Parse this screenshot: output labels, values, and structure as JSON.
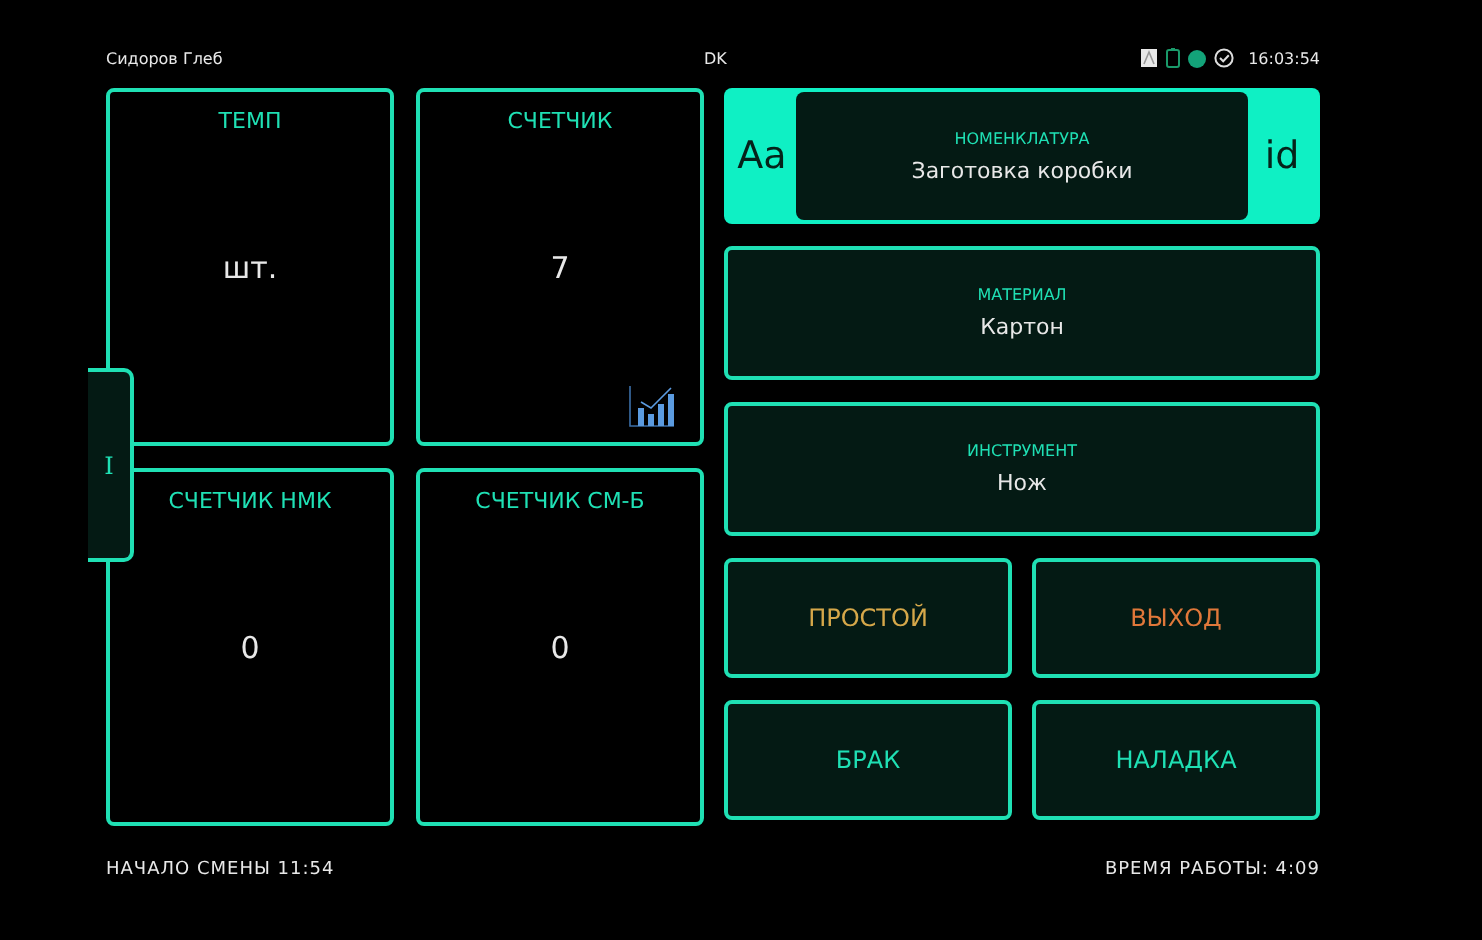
{
  "header": {
    "user": "Сидоров Глеб",
    "code": "DK",
    "time": "16:03:54"
  },
  "side_tab": {
    "label": "I"
  },
  "tiles": [
    {
      "title": "ТЕМП",
      "value": "шт.",
      "has_chart": false
    },
    {
      "title": "СЧЕТЧИК",
      "value": "7",
      "has_chart": true
    },
    {
      "title": "СЧЕТЧИК НМК",
      "value": "0",
      "has_chart": false
    },
    {
      "title": "СЧЕТЧИК СМ-Б",
      "value": "0",
      "has_chart": false
    }
  ],
  "nomenclature": {
    "left": "Aa",
    "label": "НОМЕНКЛАТУРА",
    "value": "Заготовка коробки",
    "right": "id"
  },
  "fields": [
    {
      "label": "МАТЕРИАЛ",
      "value": "Картон"
    },
    {
      "label": "ИНСТРУМЕНТ",
      "value": "Нож"
    }
  ],
  "buttons": [
    {
      "label": "ПРОСТОЙ",
      "color": "#d6a84a"
    },
    {
      "label": "ВЫХОД",
      "color": "#e0783a"
    },
    {
      "label": "БРАК",
      "color": "#1fe0b4"
    },
    {
      "label": "НАЛАДКА",
      "color": "#1fe0b4"
    }
  ],
  "footer": {
    "shift_start": "НАЧАЛО СМЕНЫ 11:54",
    "work_time": "ВРЕМЯ РАБОТЫ: 4:09"
  }
}
